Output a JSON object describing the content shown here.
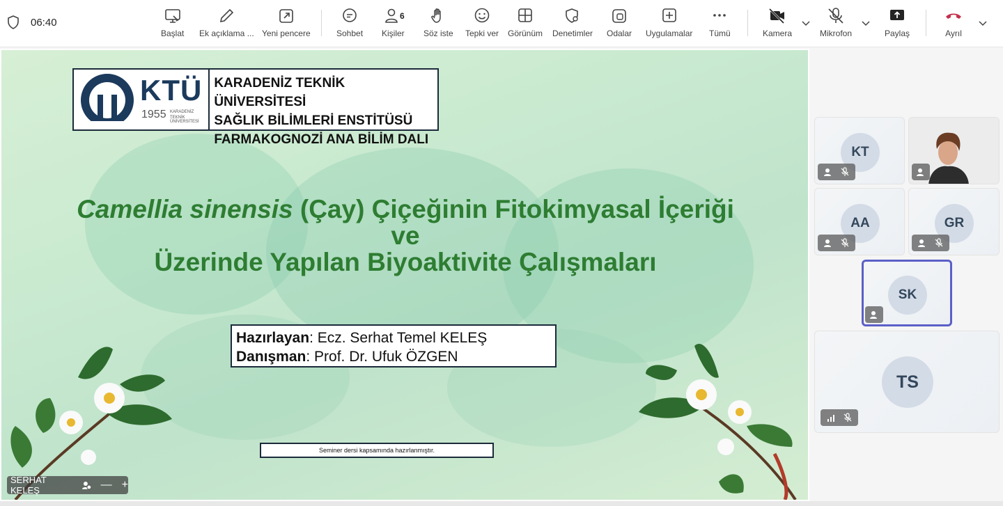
{
  "status": {
    "time": "06:40"
  },
  "toolbar": {
    "start_label": "Başlat",
    "annotate_label": "Ek açıklama ...",
    "newwin_label": "Yeni pencere",
    "chat_label": "Sohbet",
    "people_label": "Kişiler",
    "people_count": "6",
    "raise_label": "Söz iste",
    "react_label": "Tepki ver",
    "view_label": "Görünüm",
    "controls_label": "Denetimler",
    "rooms_label": "Odalar",
    "apps_label": "Uygulamalar",
    "more_label": "Tümü",
    "camera_label": "Kamera",
    "mic_label": "Mikrofon",
    "share_label": "Paylaş",
    "leave_label": "Ayrıl",
    "leave_color": "#c4314b"
  },
  "slide": {
    "logo_text": "KTÜ",
    "logo_year": "1955",
    "logo_sub1": "KARADENİZ",
    "logo_sub2": "TEKNİK ÜNİVERSİTESİ",
    "inst_line1": "KARADENİZ TEKNİK ÜNİVERSİTESİ",
    "inst_line2": "SAĞLIK BİLİMLERİ ENSTİTÜSÜ",
    "inst_line3": "FARMAKOGNOZİ ANA BİLİM DALI",
    "title_italic": "Camellia sinensis",
    "title_rest": " (Çay) Çiçeğinin Fitokimyasal İçeriği",
    "title_line2": "ve",
    "title_line3": "Üzerinde Yapılan Biyoaktivite Çalışmaları",
    "prepared_label": "Hazırlayan",
    "prepared_value": ": Ecz. Serhat Temel KELEŞ",
    "advisor_label": "Danışman",
    "advisor_value": ": Prof. Dr. Ufuk ÖZGEN",
    "note": "Seminer dersi kapsamında hazırlanmıştır.",
    "title_color": "#2e7d32"
  },
  "presenter": {
    "name": "SERHAT KELEŞ",
    "minus": "—",
    "plus": "+"
  },
  "participants": [
    {
      "initials": "KT"
    },
    {
      "initials": ""
    },
    {
      "initials": "AA"
    },
    {
      "initials": "GR"
    },
    {
      "initials": "SK"
    },
    {
      "initials": "TS"
    }
  ]
}
